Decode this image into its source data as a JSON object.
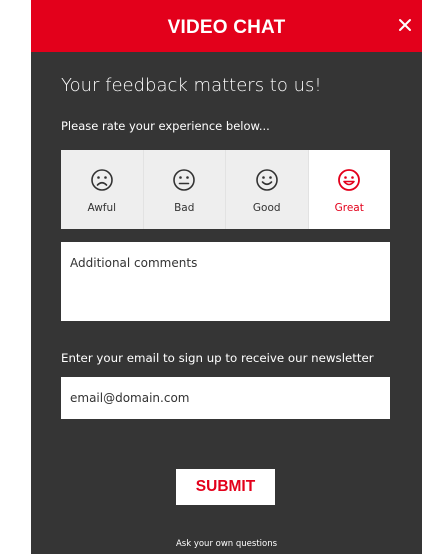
{
  "header": {
    "title": "VIDEO CHAT",
    "close_icon": "close-icon",
    "background_color": "#e3001b"
  },
  "feedback": {
    "headline": "Your feedback matters to us!",
    "prompt": "Please rate your experience below...",
    "ratings": [
      {
        "label": "Awful",
        "icon": "frown-face-icon",
        "selected": false
      },
      {
        "label": "Bad",
        "icon": "neutral-face-icon",
        "selected": false
      },
      {
        "label": "Good",
        "icon": "smile-face-icon",
        "selected": false
      },
      {
        "label": "Great",
        "icon": "grin-face-icon",
        "selected": true
      }
    ],
    "comments_placeholder": "Additional comments"
  },
  "newsletter": {
    "label": "Enter your email to sign up to receive our newsletter",
    "email_placeholder": "email@domain.com"
  },
  "submit_label": "SUBMIT",
  "footer_link": "Ask your own questions",
  "colors": {
    "accent": "#e3001b",
    "panel": "#353535"
  }
}
